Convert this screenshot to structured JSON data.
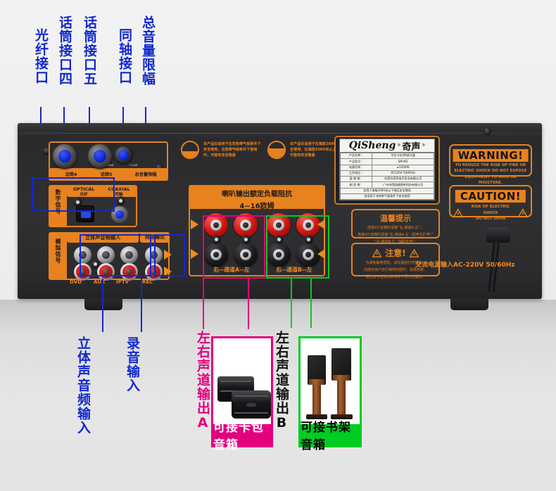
{
  "top_callouts": [
    {
      "name": "optical-port",
      "text": "光纤接口"
    },
    {
      "name": "mic-port-4",
      "text": "话筒接口四"
    },
    {
      "name": "mic-port-5",
      "text": "话筒接口五"
    },
    {
      "name": "coaxial-port",
      "text": "同轴接口"
    },
    {
      "name": "master-volume-limit",
      "text": "总音量限幅"
    }
  ],
  "left_callouts": [
    {
      "name": "digital-signal",
      "text": "数字信号"
    },
    {
      "name": "analog-signal",
      "text": "模拟信号"
    }
  ],
  "bottom_callouts": [
    {
      "name": "stereo-audio-input",
      "text": "立体声音频输入",
      "color": "#1128cf"
    },
    {
      "name": "recording-input",
      "text": "录音输入",
      "color": "#1128cf"
    },
    {
      "name": "lr-channel-output-a",
      "text": "左右声道输出A",
      "color": "#e3007f"
    },
    {
      "name": "lr-channel-output-b",
      "text": "左右声道输出B",
      "color": "#111111"
    }
  ],
  "panel": {
    "mic_section": {
      "mic4_label": "话筒4",
      "mic5_label": "话筒5",
      "volume_label": "总音量限幅",
      "volume_scale_min": "-6dB",
      "volume_scale_max": "+12dB"
    },
    "digital_section": {
      "side_label": "数字信号",
      "optical_en": "OPTICAL",
      "optical_cn": "光纤",
      "coaxial_en": "COAXIAL",
      "coaxial_cn": "同轴"
    },
    "analog_section": {
      "side_label": "模拟信号",
      "stereo_input_header": "立体声音频输入",
      "line_output_header": "线路输出",
      "jacks": [
        "DVD",
        "AUX",
        "IPTV"
      ],
      "rec_jack": "REC"
    },
    "speaker_section": {
      "header_line1": "喇叭输出额定负载阻抗",
      "header_line2": "4~16欧姆",
      "channel_a_label": "右--通道A--左",
      "channel_b_label": "右--通道B--左"
    },
    "climate_notes": [
      "本产品仅适用于在非热带气候条件下安全使用，在热带气候条件下使用时，可能有安全隐患",
      "本产品仅适用于在海拔2000米以下安全使用，在海拔2000米以上使用时，可能有安全隐患"
    ],
    "spec_plate": {
      "brand_en": "QiSheng",
      "brand_cn": "奇声",
      "registered_mark": "®",
      "rows": [
        [
          "产品名称：",
          "专业卡拉OK放大器"
        ],
        [
          "产品型号：",
          "SM-M3"
        ],
        [
          "电源功率：",
          "≥1200W"
        ],
        [
          "工作电压：",
          "AC220V 50/60Hz"
        ],
        [
          "监 制 商：",
          "东莞市奇声电子实业有限公司"
        ],
        [
          "制 造 商：",
          "广州市西欧威视听科技有限公司"
        ]
      ],
      "footnotes": [
        "仅用于海拔2000米以下地区安全使用",
        "仅适用于非热带气候条件下安全使用"
      ]
    },
    "warning_box": {
      "title": "WARNING!",
      "body": "TO REDUCE THE RISK OF FIRE OR ELECTRIC SHOCK DO NOT EXPOSE EQUIPMENT TO RAIN OR MOISTURE."
    },
    "caution_box": {
      "title": "CAUTION!",
      "body_line1": "RISK OF ELECTRIC SHOCK",
      "body_line2": "DO NOT OPEN"
    },
    "tips_box": {
      "title": "温馨提示",
      "line1": "连接2只音箱时请接“右-通道A-左”；",
      "line2": "连接4只音箱时请接“右-通道A-左（前声主扩声）”",
      "line3": "“右-通道B-左（辅助补声）”"
    },
    "attention_box": {
      "title": "注意!",
      "line1": "为避免触电危险，请勿擅自打开机盖，",
      "line2": "内部无用户自行维修的部件，如需检修，",
      "line3": "请让有专业知识的维修人员为您服务。"
    },
    "ac_note": "交流电源输入AC-220V 50/60Hz"
  },
  "product_cards": [
    {
      "name": "karaoke-speaker-card",
      "caption": "可接卡包音箱",
      "color": "#e3007f"
    },
    {
      "name": "bookshelf-speaker-card",
      "caption": "可接书架音箱",
      "color": "#00cc22"
    }
  ],
  "colors": {
    "blue": "#1128cf",
    "magenta": "#e3007f",
    "green": "#00cc22",
    "orange": "#e8821e",
    "panel_dark": "#2e2e30"
  }
}
